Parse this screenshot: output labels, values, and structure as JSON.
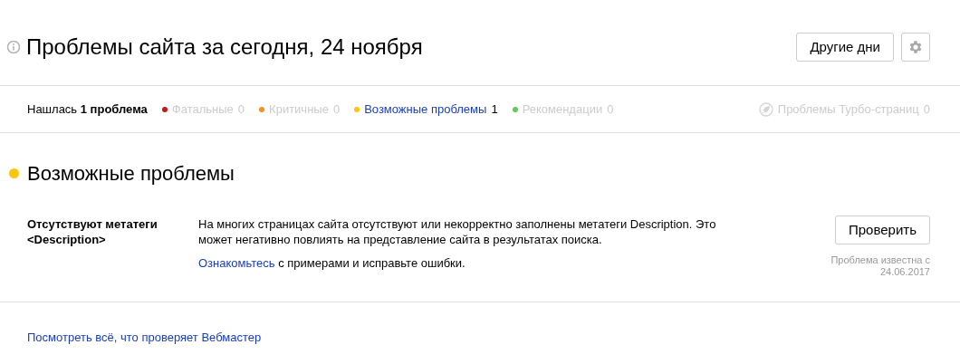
{
  "header": {
    "title": "Проблемы сайта за сегодня, 24 ноября",
    "other_days_button": "Другие дни"
  },
  "summary": {
    "found": "Нашлась **1 проблема**",
    "filters": [
      {
        "label": "Фатальные",
        "count": "0",
        "color": "#c2191c",
        "active": false
      },
      {
        "label": "Критичные",
        "count": "0",
        "color": "#f88f1c",
        "active": false
      },
      {
        "label": "Возможные проблемы",
        "count": "1",
        "color": "#fcc508",
        "active": true
      },
      {
        "label": "Рекомендации",
        "count": "0",
        "color": "#5fca5b",
        "active": false
      }
    ],
    "turbo": {
      "label": "Проблемы Турбо-страниц",
      "count": "0",
      "active": false
    }
  },
  "section": {
    "title": "Возможные проблемы",
    "color": "#fcc508",
    "problems": [
      {
        "name": "Отсутствуют метатеги <Description>",
        "description": "На многих страницах сайта отсутствуют или некорректно заполнены метатеги Description. Это может негативно повлиять на представление сайта в результатах поиска.",
        "hint_link": "Ознакомьтесь",
        "hint_text": "с примерами и исправьте ошибки.",
        "button": "Проверить",
        "known_since": "Проблема известна с 24.06.2017"
      }
    ]
  },
  "footer_link": "Посмотреть всё, что проверяет Вебмастер"
}
